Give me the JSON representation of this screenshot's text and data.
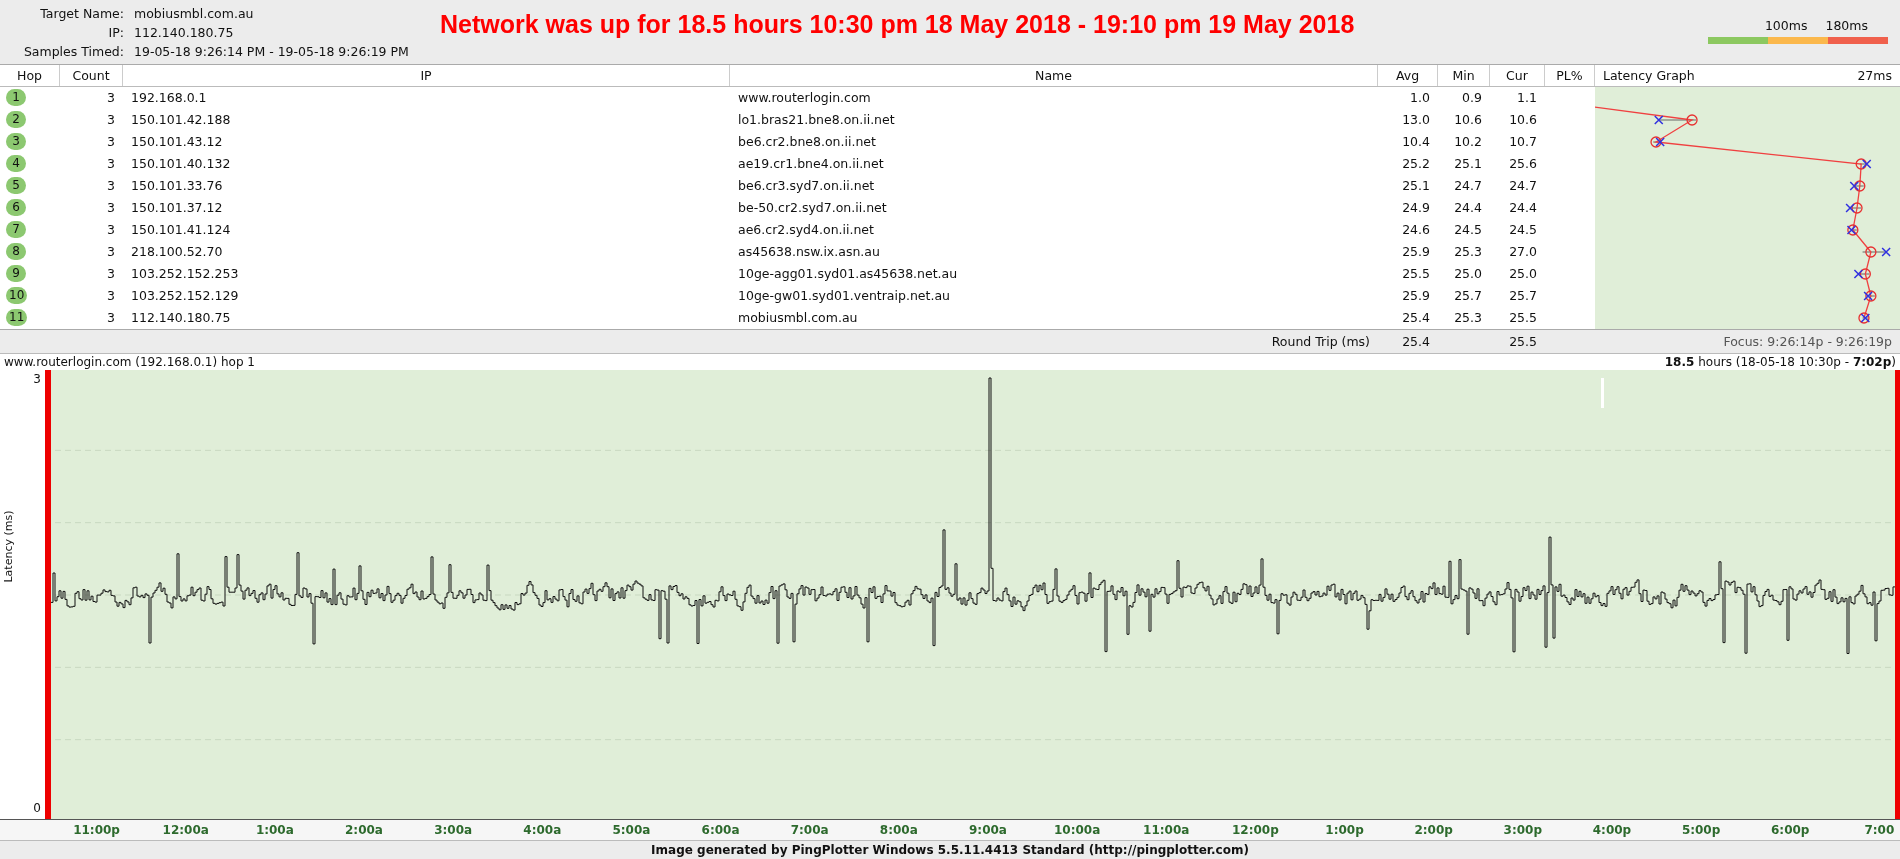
{
  "target": {
    "fields": [
      {
        "label": "Target Name:",
        "value": "mobiusmbl.com.au"
      },
      {
        "label": "IP:",
        "value": "112.140.180.75"
      },
      {
        "label": "Samples Timed:",
        "value": "19-05-18 9:26:14 PM - 19-05-18 9:26:19 PM"
      }
    ]
  },
  "annotation": "Network was up for 18.5 hours 10:30 pm 18 May 2018 - 19:10 pm 19 May 2018",
  "legend": {
    "labels": [
      "100ms",
      "180ms"
    ],
    "segments": [
      {
        "color": "#8cc860"
      },
      {
        "color": "#fbb84c"
      },
      {
        "color": "#f0604c"
      }
    ]
  },
  "table": {
    "columns": [
      "Hop",
      "Count",
      "IP",
      "Name",
      "Avg",
      "Min",
      "Cur",
      "PL%",
      "Latency Graph"
    ],
    "graph_scale": "27ms",
    "rows": [
      {
        "hop": "1",
        "count": "3",
        "ip": "192.168.0.1",
        "name": "www.routerlogin.com",
        "avg": "1.0",
        "min": "0.9",
        "cur": "1.1"
      },
      {
        "hop": "2",
        "count": "3",
        "ip": "150.101.42.188",
        "name": "lo1.bras21.bne8.on.ii.net",
        "avg": "13.0",
        "min": "10.6",
        "cur": "10.6"
      },
      {
        "hop": "3",
        "count": "3",
        "ip": "150.101.43.12",
        "name": "be6.cr2.bne8.on.ii.net",
        "avg": "10.4",
        "min": "10.2",
        "cur": "10.7"
      },
      {
        "hop": "4",
        "count": "3",
        "ip": "150.101.40.132",
        "name": "ae19.cr1.bne4.on.ii.net",
        "avg": "25.2",
        "min": "25.1",
        "cur": "25.6"
      },
      {
        "hop": "5",
        "count": "3",
        "ip": "150.101.33.76",
        "name": "be6.cr3.syd7.on.ii.net",
        "avg": "25.1",
        "min": "24.7",
        "cur": "24.7"
      },
      {
        "hop": "6",
        "count": "3",
        "ip": "150.101.37.12",
        "name": "be-50.cr2.syd7.on.ii.net",
        "avg": "24.9",
        "min": "24.4",
        "cur": "24.4"
      },
      {
        "hop": "7",
        "count": "3",
        "ip": "150.101.41.124",
        "name": "ae6.cr2.syd4.on.ii.net",
        "avg": "24.6",
        "min": "24.5",
        "cur": "24.5"
      },
      {
        "hop": "8",
        "count": "3",
        "ip": "218.100.52.70",
        "name": "as45638.nsw.ix.asn.au",
        "avg": "25.9",
        "min": "25.3",
        "cur": "27.0"
      },
      {
        "hop": "9",
        "count": "3",
        "ip": "103.252.152.253",
        "name": "10ge-agg01.syd01.as45638.net.au",
        "avg": "25.5",
        "min": "25.0",
        "cur": "25.0"
      },
      {
        "hop": "10",
        "count": "3",
        "ip": "103.252.152.129",
        "name": "10ge-gw01.syd01.ventraip.net.au",
        "avg": "25.9",
        "min": "25.7",
        "cur": "25.7"
      },
      {
        "hop": "11",
        "count": "3",
        "ip": "112.140.180.75",
        "name": "mobiusmbl.com.au",
        "avg": "25.4",
        "min": "25.3",
        "cur": "25.5"
      }
    ],
    "round_trip": {
      "label": "Round Trip (ms)",
      "avg": "25.4",
      "cur": "25.5"
    },
    "focus": "Focus: 9:26:14p - 9:26:19p"
  },
  "timeline": {
    "title": "www.routerlogin.com (192.168.0.1) hop 1",
    "range": "**18.5** hours (18-05-18  10:30p - **7:02p**)",
    "ylabel": "Latency (ms)",
    "ytop": "3",
    "ybottom": "0",
    "xticks": [
      "11:00p",
      "12:00a",
      "1:00a",
      "2:00a",
      "3:00a",
      "4:00a",
      "5:00a",
      "6:00a",
      "7:00a",
      "8:00a",
      "9:00a",
      "10:00a",
      "11:00a",
      "12:00p",
      "1:00p",
      "2:00p",
      "3:00p",
      "4:00p",
      "5:00p",
      "6:00p",
      "7:00"
    ]
  },
  "footer": "Image generated by PingPlotter Windows 5.5.11.4413 Standard (http://pingplotter.com)"
}
